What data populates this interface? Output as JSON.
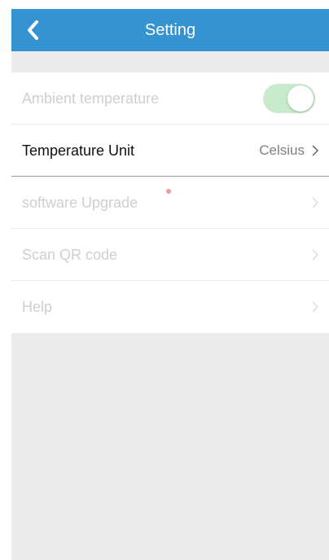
{
  "header": {
    "title": "Setting",
    "back_icon": "chevron-left-icon",
    "background_color": "#3593d2"
  },
  "settings": {
    "items": [
      {
        "label": "Ambient temperature",
        "control": "toggle",
        "toggle_on": true,
        "enabled": false
      },
      {
        "label": "Temperature Unit",
        "value": "Celsius",
        "icon": "chevron-right-icon",
        "enabled": true
      },
      {
        "label": "software Upgrade",
        "icon": "chevron-right-icon",
        "enabled": false,
        "notification_dot": true
      },
      {
        "label": "Scan QR code",
        "icon": "chevron-right-icon",
        "enabled": false
      },
      {
        "label": "Help",
        "icon": "chevron-right-icon",
        "enabled": false
      }
    ]
  },
  "colors": {
    "toggle_track": "#c9ebcd",
    "notification_dot": "#f29a9a",
    "background": "#ececec"
  }
}
